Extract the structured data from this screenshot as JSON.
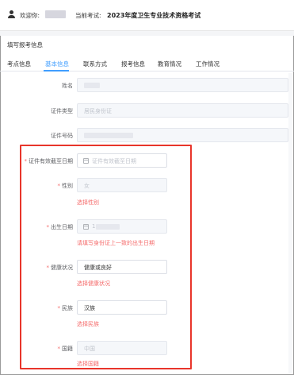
{
  "header": {
    "welcome": "欢迎你:",
    "exam_label": "当前考试:",
    "exam_name": "2023年度卫生专业技术资格考试"
  },
  "form_title": "填写报考信息",
  "tabs": [
    {
      "label": "考点信息"
    },
    {
      "label": "基本信息"
    },
    {
      "label": "联系方式"
    },
    {
      "label": "报考信息"
    },
    {
      "label": "教育情况"
    },
    {
      "label": "工作情况"
    }
  ],
  "fields": {
    "name": {
      "label": "姓名"
    },
    "id_type": {
      "label": "证件类型",
      "value": "居民身份证"
    },
    "id_number": {
      "label": "证件号码"
    },
    "id_expiry": {
      "label": "证件有效截至日期",
      "placeholder": "证件有效截至日期"
    },
    "gender": {
      "label": "性别",
      "value": "女",
      "error": "选择性别"
    },
    "birthdate": {
      "label": "出生日期",
      "value_prefix": "1",
      "error": "请填写身份证上一致的出生日期"
    },
    "health": {
      "label": "健康状况",
      "value": "健康或良好",
      "error": "选择健康状况"
    },
    "ethnicity": {
      "label": "民族",
      "value": "汉族",
      "error": "选择民族"
    },
    "nationality": {
      "label": "国籍",
      "value": "中国",
      "error": "选择国籍"
    }
  },
  "required_mark": "*",
  "colors": {
    "accent": "#409eff",
    "error": "#f56c6c",
    "highlight_box": "#e8352b"
  }
}
